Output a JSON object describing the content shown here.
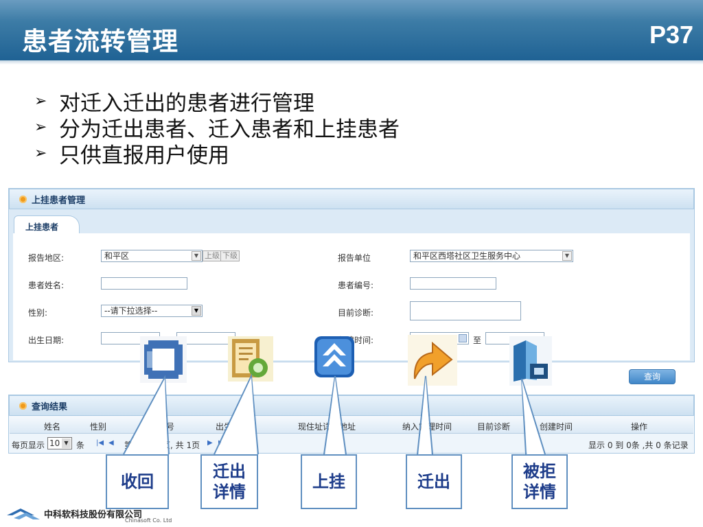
{
  "slide": {
    "title": "患者流转管理",
    "page": "P37"
  },
  "bullets": [
    "对迁入迁出的患者进行管理",
    "分为迁出患者、迁入患者和上挂患者",
    "只供直报用户使用"
  ],
  "panel1": {
    "title": "上挂患者管理",
    "tab": "上挂患者",
    "fields": {
      "region_label": "报告地区:",
      "region_value": "和平区",
      "up_btn": "上级",
      "down_btn": "下级",
      "unit_label": "报告单位",
      "unit_value": "和平区西塔社区卫生服务中心",
      "name_label": "患者姓名:",
      "code_label": "患者编号:",
      "gender_label": "性别:",
      "gender_value": "--请下拉选择--",
      "diag_label": "目前诊断:",
      "birth_label": "出生日期:",
      "create_label": "创建时间:",
      "to_label": "至"
    },
    "query_btn": "查询"
  },
  "panel2": {
    "title": "查询结果",
    "columns": [
      "姓名",
      "性别",
      "患者编号",
      "出生日期",
      "现住址详细地址",
      "纳入管理时间",
      "目前诊断",
      "创建时间",
      "操作"
    ],
    "pager": {
      "per_page_label": "每页显示",
      "per_page_value": "10",
      "unit": "条",
      "page_prefix": "第",
      "page_value": "1",
      "page_suffix": "页, 共 1页",
      "summary": "显示 0 到 0条 ,共 0 条记录"
    }
  },
  "callouts": [
    {
      "label": "收回"
    },
    {
      "label": "迁出\n详情"
    },
    {
      "label": "上挂"
    },
    {
      "label": "迁出"
    },
    {
      "label": "被拒\n详情"
    }
  ],
  "footer": {
    "company": "中科软科技股份有限公司",
    "sub": "Chinasoft Co. Ltd"
  }
}
